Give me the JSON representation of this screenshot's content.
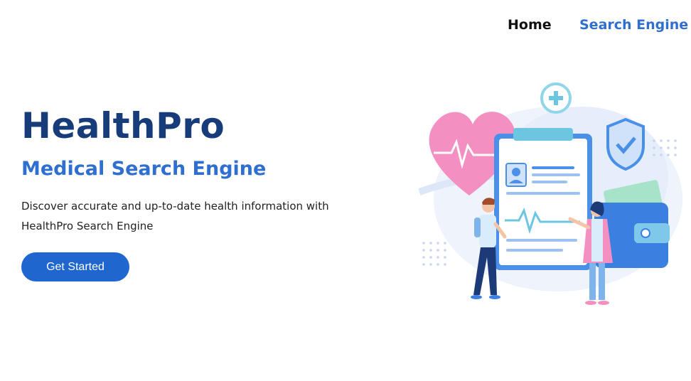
{
  "nav": {
    "home": "Home",
    "search_engine": "Search Engine"
  },
  "hero": {
    "title": "HealthPro",
    "subtitle": "Medical Search Engine",
    "description_line1": "Discover accurate and up-to-date health information with",
    "description_line2": "HealthPro Search Engine",
    "cta_label": "Get Started"
  },
  "colors": {
    "brand_dark": "#173c7a",
    "accent_blue": "#2f6fd0",
    "button_blue": "#1f66cf",
    "heart_pink": "#f48fc2"
  },
  "illustration_icons": [
    "heart-icon",
    "medical-cross-icon",
    "shield-check-icon",
    "clipboard-icon",
    "wallet-icon"
  ]
}
